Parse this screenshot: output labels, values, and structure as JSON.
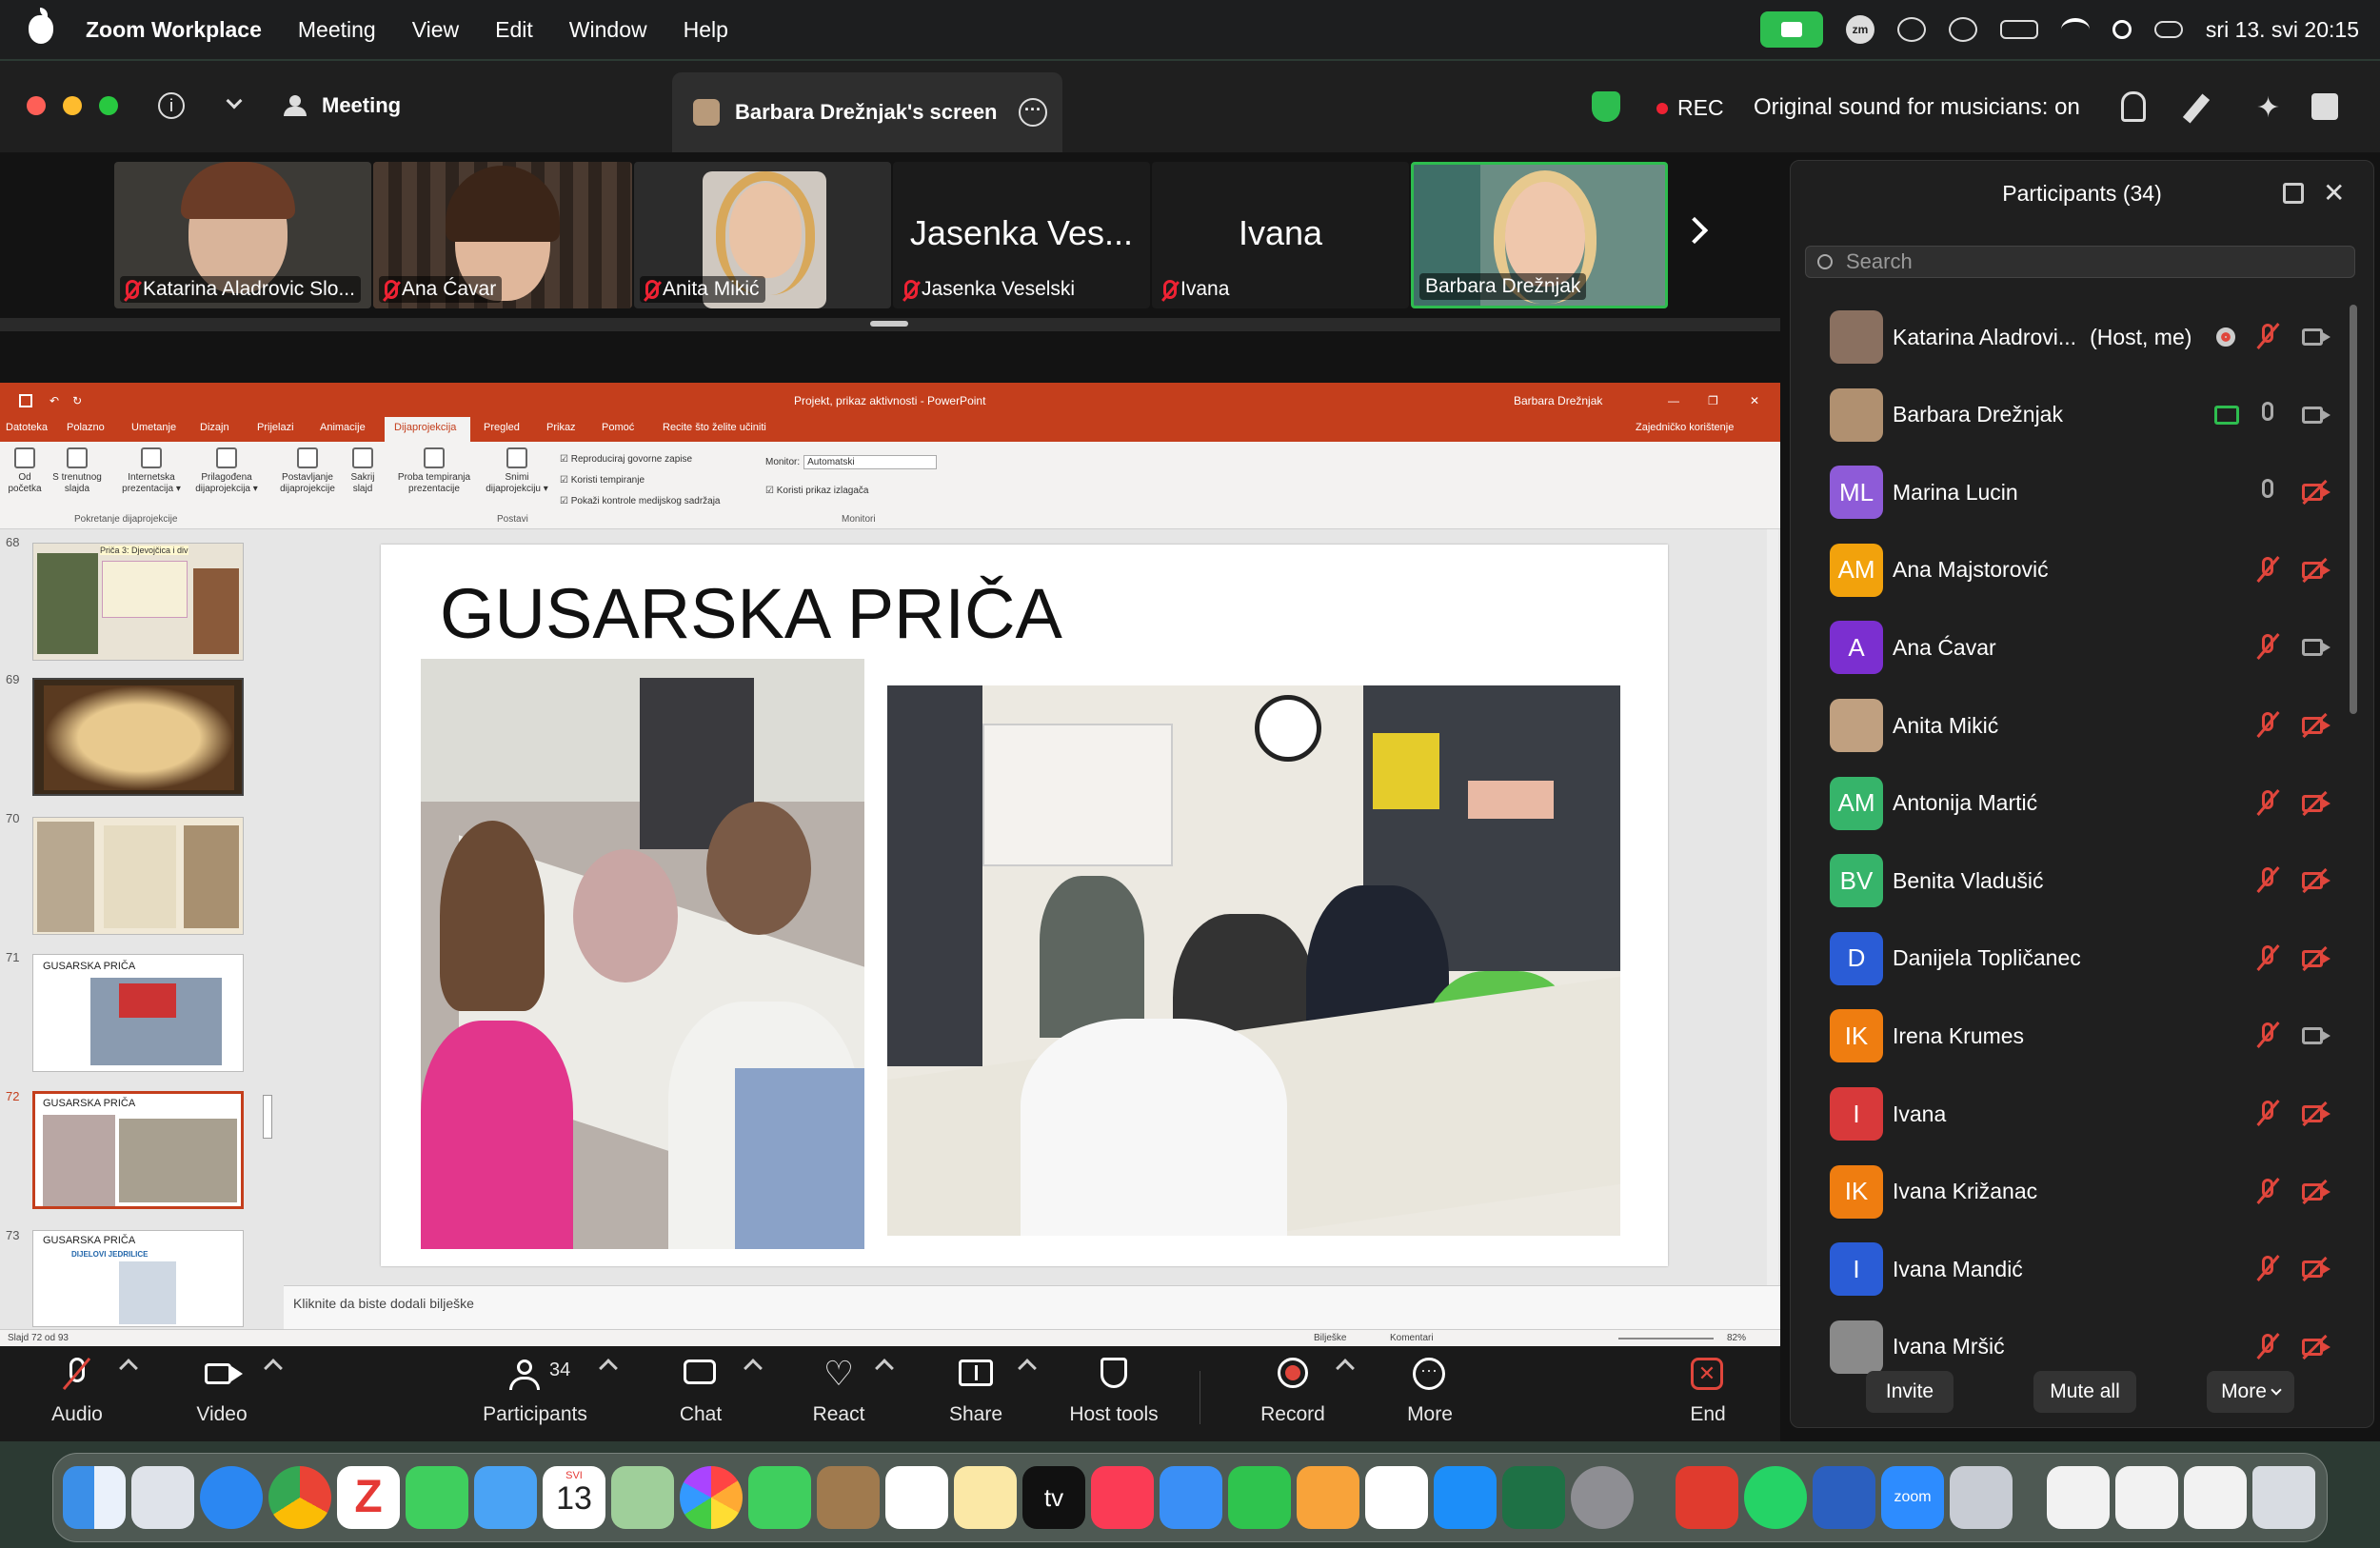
{
  "menubar": {
    "app_name": "Zoom Workplace",
    "menus": [
      "Meeting",
      "View",
      "Edit",
      "Window",
      "Help"
    ],
    "zm_label": "zm",
    "datetime": "sri 13. svi  20:15"
  },
  "titlebar": {
    "meeting_label": "Meeting",
    "share_tab_label": "Barbara Drežnjak's screen",
    "rec_label": "REC",
    "original_sound": "Original sound for musicians: on"
  },
  "video_strip": [
    {
      "name": "Katarina Aladrovic Slo...",
      "muted": true,
      "video": true
    },
    {
      "name": "Ana Ćavar",
      "muted": true,
      "video": true
    },
    {
      "name": "Anita Mikić",
      "muted": true,
      "video": true
    },
    {
      "name": "Jasenka Veselski",
      "big_name": "Jasenka Ves...",
      "muted": true,
      "video": false
    },
    {
      "name": "Ivana",
      "big_name": "Ivana",
      "muted": true,
      "video": false
    },
    {
      "name": "Barbara Drežnjak",
      "muted": false,
      "video": true
    }
  ],
  "powerpoint": {
    "title": "Projekt, prikaz aktivnosti  -  PowerPoint",
    "user": "Barbara Drežnjak",
    "tabs": [
      "Datoteka",
      "Polazno",
      "Umetanje",
      "Dizajn",
      "Prijelazi",
      "Animacije",
      "Dijaprojekcija",
      "Pregled",
      "Prikaz",
      "Pomoć"
    ],
    "active_tab": "Dijaprojekcija",
    "tell_me": "Recite što želite učiniti",
    "share": "Zajedničko korištenje",
    "ribbon_buttons": [
      {
        "l1": "Od",
        "l2": "početka"
      },
      {
        "l1": "S trenutnog",
        "l2": "slajda"
      },
      {
        "l1": "Internetska",
        "l2": "prezentacija ▾"
      },
      {
        "l1": "Prilagođena",
        "l2": "dijaprojekcija ▾"
      },
      {
        "l1": "Postavljanje",
        "l2": "dijaprojekcije"
      },
      {
        "l1": "Sakrij",
        "l2": "slajd"
      },
      {
        "l1": "Proba tempiranja",
        "l2": "prezentacije"
      },
      {
        "l1": "Snimi",
        "l2": "dijaprojekciju ▾"
      }
    ],
    "checkboxes": [
      "Reproduciraj govorne zapise",
      "Koristi tempiranje",
      "Pokaži kontrole medijskog sadržaja"
    ],
    "monitor_label": "Monitor:",
    "monitor_value": "Automatski",
    "presenter_view": "Koristi prikaz izlagača",
    "groups": [
      "Pokretanje dijaprojekcije",
      "Postavi",
      "Monitori"
    ],
    "slide_numbers": [
      "68",
      "69",
      "70",
      "71",
      "72",
      "73"
    ],
    "thumb_title": "GUSARSKA PRIČA",
    "thumb68_text": "Priča 3: Djevojčica i div",
    "thumb73_sub": "DIJELOVI JEDRILICE",
    "slide_title": "GUSARSKA PRIČA",
    "notes_placeholder": "Kliknite da biste dodali bilješke",
    "status_left": "Slajd 72 od 93",
    "status_notes": "Bilješke",
    "status_comments": "Komentari",
    "zoom_level": "82%"
  },
  "toolbar": {
    "audio": "Audio",
    "video": "Video",
    "participants": "Participants",
    "participants_count": "34",
    "chat": "Chat",
    "react": "React",
    "share": "Share",
    "host_tools": "Host tools",
    "record": "Record",
    "more": "More",
    "end": "End"
  },
  "participants_panel": {
    "title": "Participants (34)",
    "search_placeholder": "Search",
    "participants": [
      {
        "name": "Katarina Aladrovi...",
        "tag": "(Host, me)",
        "initials": "",
        "color": "#8a7060",
        "photo": true,
        "mic": "muted",
        "cam": "on",
        "rec": true
      },
      {
        "name": "Barbara Drežnjak",
        "tag": "",
        "initials": "",
        "color": "#b09070",
        "photo": true,
        "mic": "on",
        "cam": "on",
        "sharing": true
      },
      {
        "name": "Marina Lucin",
        "tag": "",
        "initials": "ML",
        "color": "#8e5bd8",
        "mic": "on",
        "cam": "off"
      },
      {
        "name": "Ana Majstorović",
        "tag": "",
        "initials": "AM",
        "color": "#f2a20c",
        "mic": "muted",
        "cam": "off"
      },
      {
        "name": "Ana Ćavar",
        "tag": "",
        "initials": "A",
        "color": "#7b2fd0",
        "mic": "muted",
        "cam": "on"
      },
      {
        "name": "Anita Mikić",
        "tag": "",
        "initials": "",
        "color": "#c0a080",
        "photo": true,
        "mic": "muted",
        "cam": "off"
      },
      {
        "name": "Antonija Martić",
        "tag": "",
        "initials": "AM",
        "color": "#36b46a",
        "mic": "muted",
        "cam": "off"
      },
      {
        "name": "Benita Vladušić",
        "tag": "",
        "initials": "BV",
        "color": "#36b46a",
        "mic": "muted",
        "cam": "off"
      },
      {
        "name": "Danijela Topličanec",
        "tag": "",
        "initials": "D",
        "color": "#2a5cd6",
        "mic": "muted",
        "cam": "off"
      },
      {
        "name": "Irena Krumes",
        "tag": "",
        "initials": "IK",
        "color": "#ef7d10",
        "mic": "muted",
        "cam": "on"
      },
      {
        "name": "Ivana",
        "tag": "",
        "initials": "I",
        "color": "#d8393a",
        "mic": "muted",
        "cam": "off"
      },
      {
        "name": "Ivana Križanac",
        "tag": "",
        "initials": "IK",
        "color": "#ef7d10",
        "mic": "muted",
        "cam": "off"
      },
      {
        "name": "Ivana Mandić",
        "tag": "",
        "initials": "I",
        "color": "#2a5cd6",
        "mic": "muted",
        "cam": "off"
      },
      {
        "name": "Ivana Mršić",
        "tag": "",
        "initials": "",
        "color": "#8a8a8a",
        "photo": true,
        "mic": "muted",
        "cam": "off"
      }
    ],
    "invite": "Invite",
    "mute_all": "Mute all",
    "more": "More"
  },
  "dock": {
    "calendar_month": "SVI",
    "calendar_day": "13",
    "tv_label": "tv",
    "zoom_label": "zoom"
  }
}
